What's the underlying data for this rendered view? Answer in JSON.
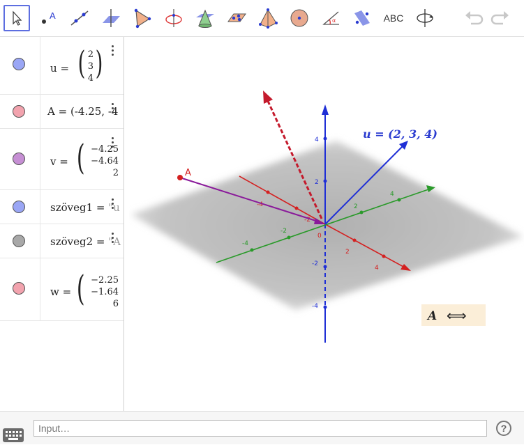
{
  "toolbar": {
    "tools": [
      "move-tool",
      "point-tool",
      "line-tool",
      "perpendicular-tool",
      "polygon-tool",
      "circle-axis-tool",
      "intersect-surfaces-tool",
      "plane-tool",
      "pyramid-tool",
      "sphere-tool",
      "angle-tool",
      "reflect-tool",
      "text-tool",
      "rotate-view-tool"
    ],
    "text_tool_label": "ABC"
  },
  "algebra": {
    "rows": [
      {
        "name": "u",
        "eq": "=",
        "matrix": [
          "2",
          "3",
          "4"
        ],
        "color": "#9aa6f5"
      },
      {
        "name": "A",
        "eq": "=",
        "value": "(-4.25, -4",
        "color": "#f2a3ae"
      },
      {
        "name": "v",
        "eq": "=",
        "matrix": [
          "−4.25",
          "−4.64",
          "2"
        ],
        "color": "#c68fd4"
      },
      {
        "name": "szöveg1",
        "eq": "=",
        "value": "\"u",
        "color": "#9aa6f5"
      },
      {
        "name": "szöveg2",
        "eq": "=",
        "value": "\"A",
        "color": "#a8a8a8"
      },
      {
        "name": "w",
        "eq": "=",
        "matrix": [
          "−2.25",
          "−1.64",
          "6"
        ],
        "color": "#f2a3ae"
      }
    ]
  },
  "graphics": {
    "vector_label": "u = (2, 3, 4)",
    "point_label": "A",
    "textbox_label": "A",
    "textbox_arrow": "⟺",
    "ticks": {
      "z": [
        "4",
        "2",
        "0",
        "-2",
        "-4"
      ],
      "x": [
        "-4",
        "-2",
        "2",
        "4"
      ],
      "y": [
        "-4",
        "-2",
        "2",
        "4"
      ]
    }
  },
  "input_bar": {
    "placeholder": "Input…",
    "help_label": "?"
  }
}
